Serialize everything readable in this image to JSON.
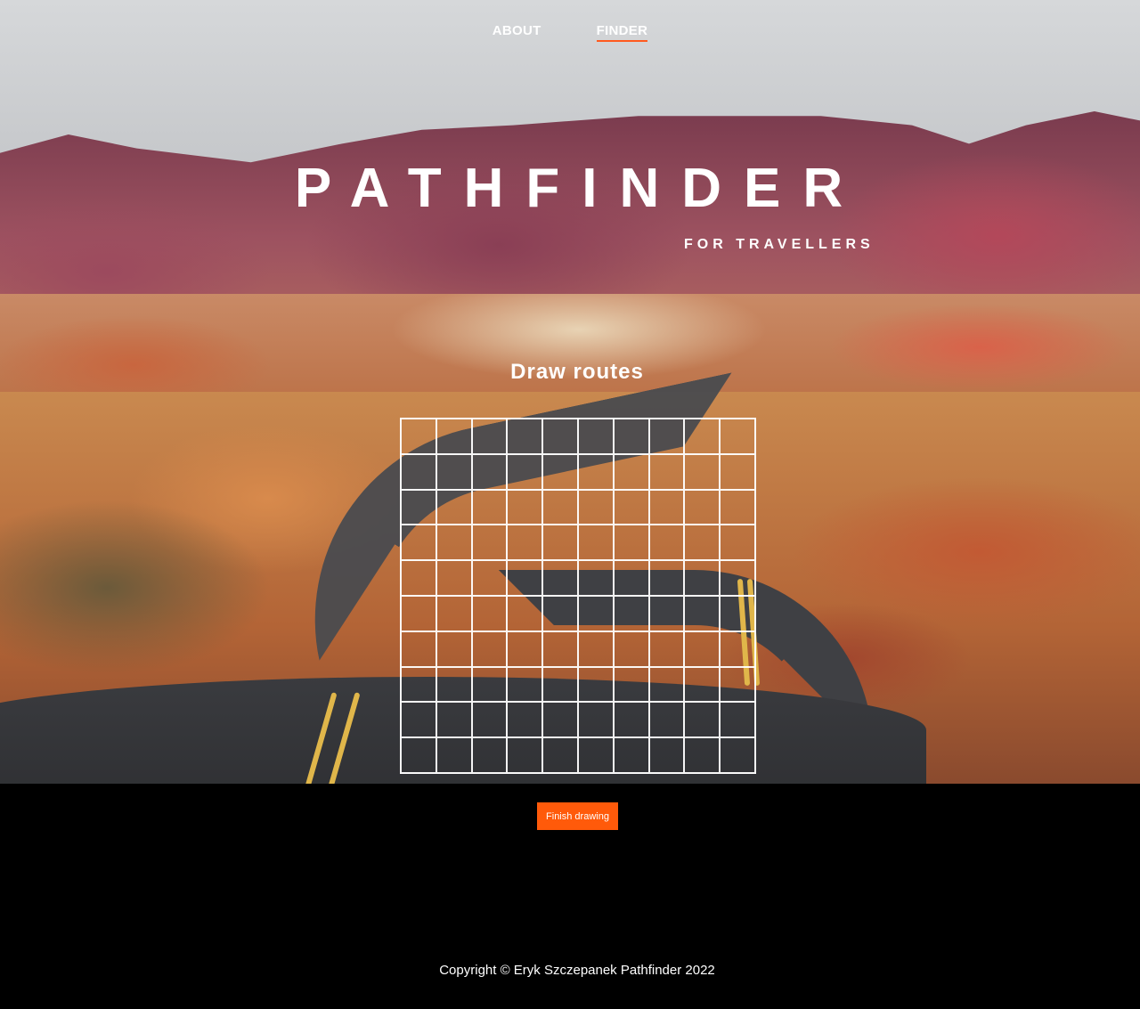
{
  "nav": {
    "items": [
      {
        "label": "ABOUT",
        "active": false
      },
      {
        "label": "FINDER",
        "active": true
      }
    ],
    "active_underline_color": "#ff5a1f"
  },
  "hero": {
    "title": "PATHFINDER",
    "subtitle": "FOR TRAVELLERS"
  },
  "finder": {
    "heading": "Draw routes",
    "grid": {
      "rows": 10,
      "columns": 10
    },
    "finish_button_label": "Finish drawing",
    "finish_button_color": "#ff5a0a"
  },
  "footer": {
    "copyright": "Copyright © Eryk Szczepanek Pathfinder 2022"
  }
}
